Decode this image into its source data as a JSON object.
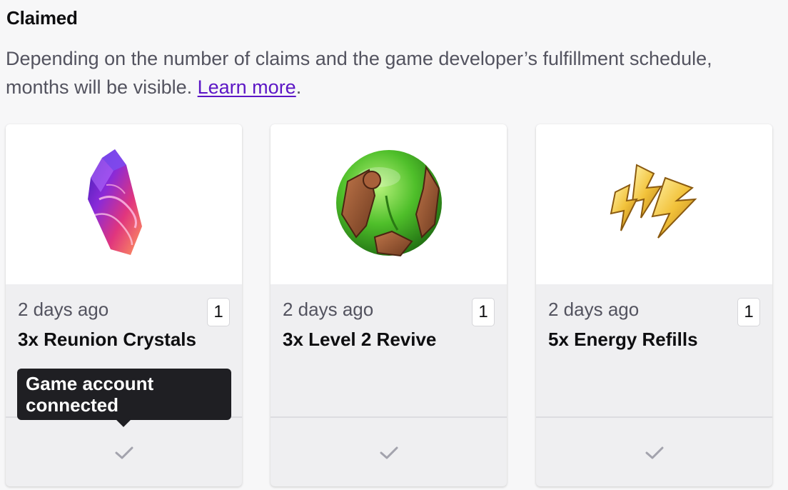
{
  "section": {
    "title": "Claimed",
    "description_line1": "Depending on the number of claims and the game developer’s fulfillment schedule,",
    "description_line2": "months will be visible.",
    "learn_more": "Learn more",
    "period": "."
  },
  "cards": [
    {
      "time": "2 days ago",
      "quantity": "1",
      "name": "3x Reunion Crystals",
      "image_icon": "crystal-icon",
      "status_icon": "check-icon"
    },
    {
      "time": "2 days ago",
      "quantity": "1",
      "name": "3x Level 2 Revive",
      "image_icon": "revive-orb-icon",
      "status_icon": "check-icon"
    },
    {
      "time": "2 days ago",
      "quantity": "1",
      "name": "5x Energy Refills",
      "image_icon": "energy-bolt-icon",
      "status_icon": "check-icon"
    }
  ],
  "tooltip": {
    "line1": "Game account",
    "line2": "connected"
  },
  "colors": {
    "link": "#5c16c5",
    "card_bg": "#efeff1",
    "tooltip_bg": "#1f1f23"
  }
}
